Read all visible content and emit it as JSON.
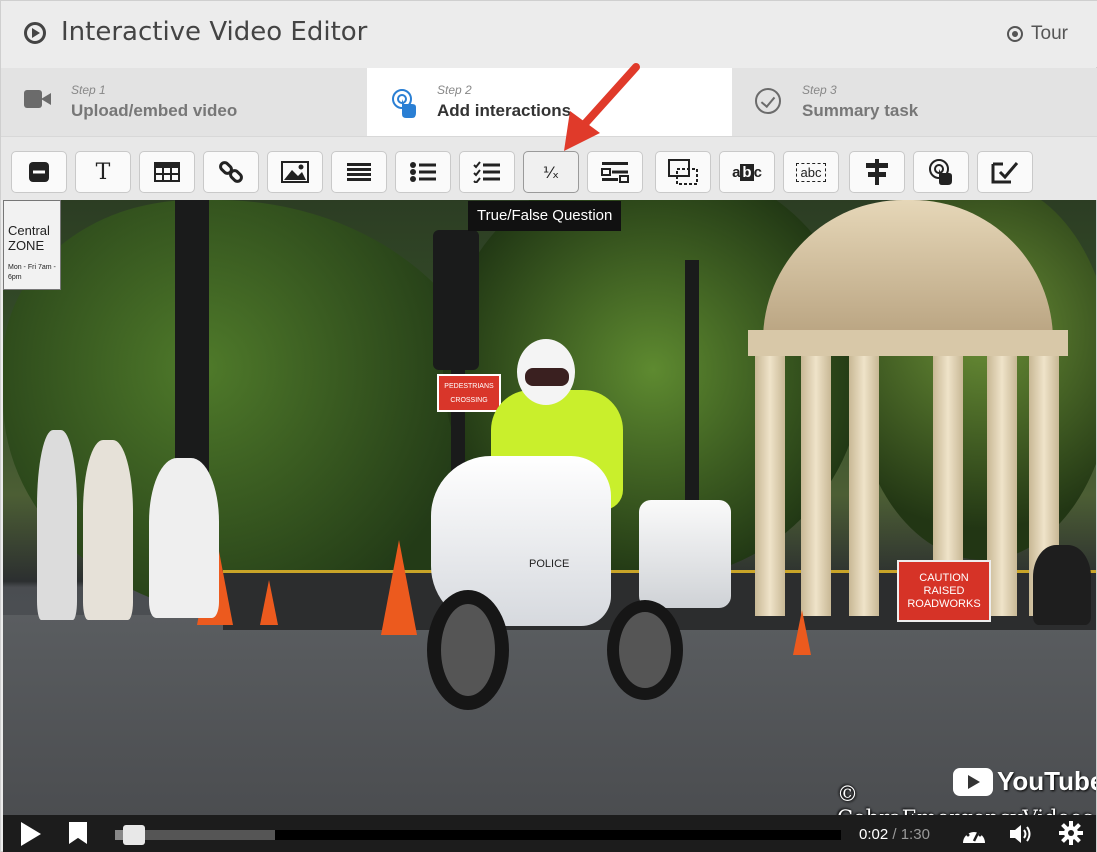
{
  "app": {
    "title": "Interactive Video Editor",
    "tour_label": "Tour"
  },
  "steps": [
    {
      "number": "Step 1",
      "label": "Upload/embed video",
      "icon": "video-camera-icon",
      "active": false
    },
    {
      "number": "Step 2",
      "label": "Add interactions",
      "icon": "touch-icon",
      "active": true
    },
    {
      "number": "Step 3",
      "label": "Summary task",
      "icon": "check-circle-icon",
      "active": false
    }
  ],
  "toolbar": {
    "buttons": [
      {
        "icon": "label-icon"
      },
      {
        "icon": "text-icon",
        "glyph": "T"
      },
      {
        "icon": "table-icon"
      },
      {
        "icon": "link-icon"
      },
      {
        "icon": "image-icon"
      },
      {
        "icon": "statements-icon"
      },
      {
        "icon": "single-choice-icon"
      },
      {
        "icon": "multiple-choice-icon"
      },
      {
        "icon": "true-false-icon",
        "glyph": "⅟ₓ"
      },
      {
        "icon": "fill-in-blanks-icon"
      },
      {
        "icon": "drag-drop-icon"
      },
      {
        "icon": "mark-words-icon",
        "glyph": "abc"
      },
      {
        "icon": "drag-text-icon",
        "glyph": "abc"
      },
      {
        "icon": "crossroads-icon"
      },
      {
        "icon": "navigation-hotspot-icon"
      },
      {
        "icon": "free-text-question-icon"
      }
    ],
    "tooltip": "True/False Question",
    "highlight_color": "#e03a2a"
  },
  "video": {
    "watermark": "© CobraEmergencyVideos",
    "youtube_label": "YouTube",
    "scene_text": {
      "zone_sign": "Central ZONE",
      "zone_hours": "Mon - Fri 7am - 6pm",
      "ped_sign": "PEDESTRIANS CROSSING",
      "caution_sign": "CAUTION RAISED ROADWORKS",
      "police_label": "POLICE"
    }
  },
  "player": {
    "current_time": "0:02",
    "separator": "/",
    "duration": "1:30",
    "played_fraction": 0.022,
    "buffered_fraction": 0.22
  }
}
